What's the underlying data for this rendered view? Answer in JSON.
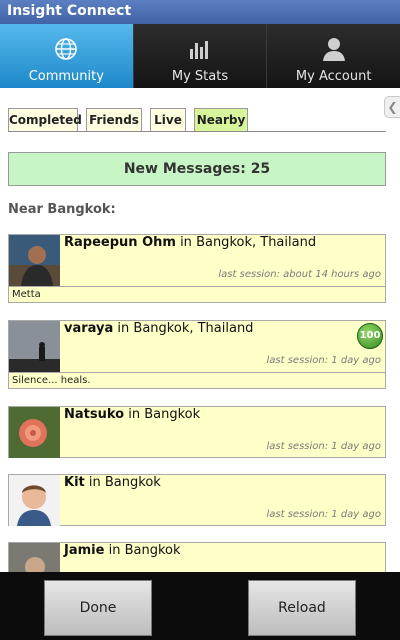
{
  "app": {
    "title": "Insight Connect"
  },
  "nav": {
    "tabs": [
      {
        "label": "Community",
        "icon": "globe-icon",
        "active": true
      },
      {
        "label": "My Stats",
        "icon": "bar-chart-icon",
        "active": false
      },
      {
        "label": "My Account",
        "icon": "person-icon",
        "active": false
      }
    ]
  },
  "filters": {
    "tabs": [
      {
        "label": "Completed",
        "active": false
      },
      {
        "label": "Friends",
        "active": false
      },
      {
        "label": "Live",
        "active": false
      },
      {
        "label": "Nearby",
        "active": true
      }
    ]
  },
  "banner": {
    "text": "New Messages: 25"
  },
  "near_heading": "Near Bangkok:",
  "users": [
    {
      "name": "Rapeepun Ohm",
      "in": "in",
      "location": "Bangkok, Thailand",
      "session": "last session: about 14 hours ago",
      "status": "Metta"
    },
    {
      "name": "varaya",
      "in": "in",
      "location": "Bangkok, Thailand",
      "session": "last session: 1 day ago",
      "status": "Silence... heals.",
      "badge": "100"
    },
    {
      "name": "Natsuko",
      "in": "in",
      "location": "Bangkok",
      "session": "last session: 1 day ago"
    },
    {
      "name": "Kit",
      "in": "in",
      "location": "Bangkok",
      "session": "last session: 1 day ago"
    },
    {
      "name": "Jamie",
      "in": "in",
      "location": "Bangkok"
    }
  ],
  "buttons": {
    "done": "Done",
    "reload": "Reload"
  },
  "colors": {
    "active_tab": "#2a9be0",
    "filter_active": "#d7f59a",
    "card_bg": "#ffffc8",
    "banner_bg": "#c7f5c5"
  }
}
